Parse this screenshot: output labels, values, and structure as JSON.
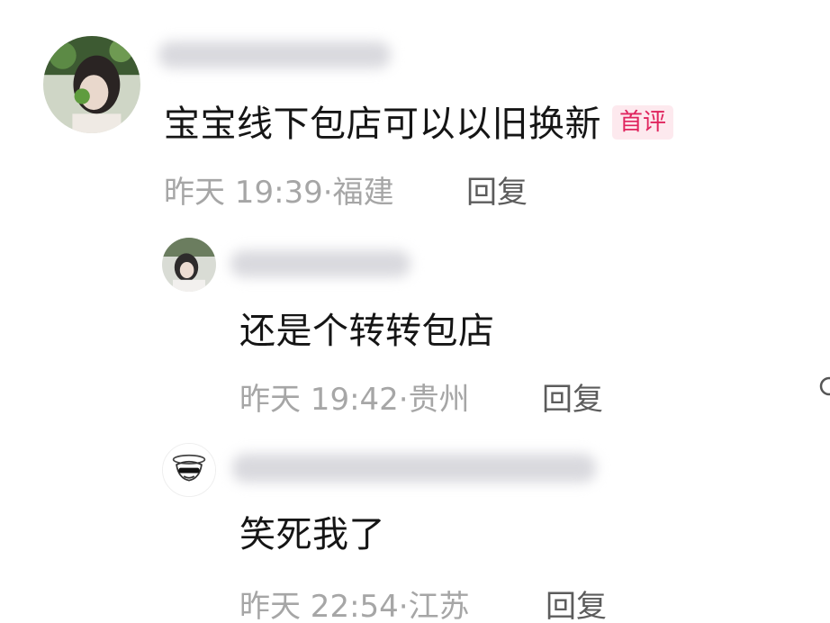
{
  "comments": [
    {
      "content": "宝宝线下包店可以以旧换新",
      "badge": "首评",
      "time": "昨天 19:39",
      "location": "福建",
      "reply_label": "回复"
    },
    {
      "content": "还是个转转包店",
      "time": "昨天 19:42",
      "location": "贵州",
      "reply_label": "回复"
    },
    {
      "content": "笑死我了",
      "time": "昨天 22:54",
      "location": "江苏",
      "reply_label": "回复"
    }
  ],
  "separator": "·",
  "icons": {
    "edge": "search-icon"
  }
}
